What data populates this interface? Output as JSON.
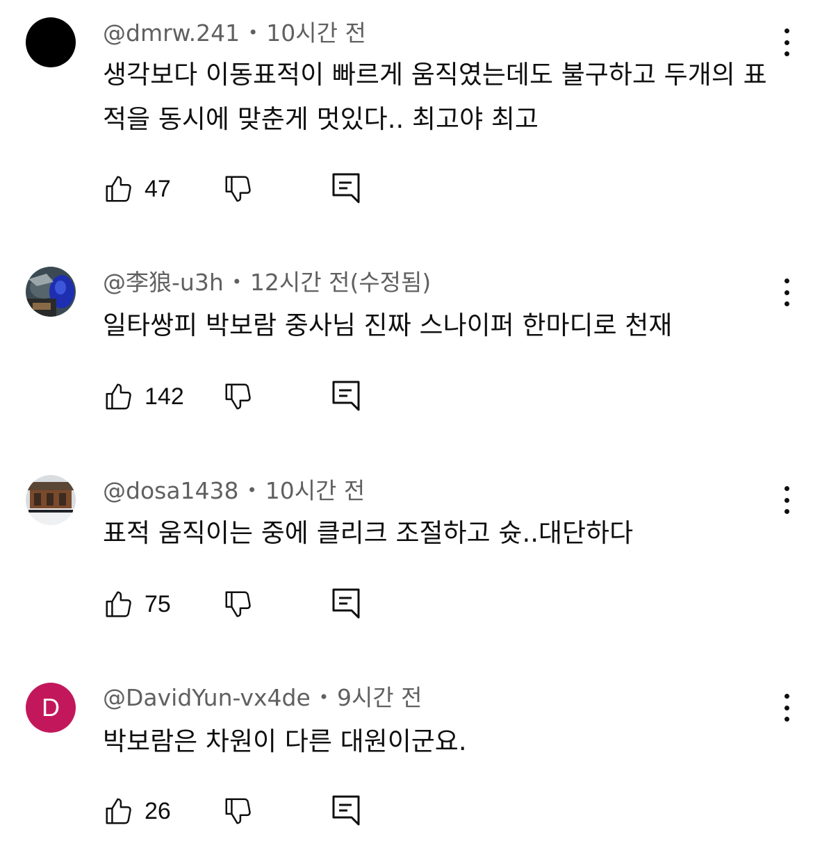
{
  "comments": [
    {
      "handle": "@dmrw.241",
      "separator": "•",
      "time": "10시간 전",
      "text": "생각보다 이동표적이 빠르게 움직였는데도 불구하고 두개의 표적을 동시에 맞춘게 멋있다.. 최고야 최고",
      "likes": "47",
      "avatar": "black-circle"
    },
    {
      "handle": "@李狼-u3h",
      "separator": "•",
      "time": "12시간 전(수정됨)",
      "text": "일타쌍피 박보람 중사님 진짜 스나이퍼 한마디로 천재",
      "likes": "142",
      "avatar": "photo-blue"
    },
    {
      "handle": "@dosa1438",
      "separator": "•",
      "time": "10시간 전",
      "text": "표적 움직이는 중에 클리크 조절하고 슛..대단하다",
      "likes": "75",
      "avatar": "photo-building"
    },
    {
      "handle": "@DavidYun-vx4de",
      "separator": "•",
      "time": "9시간 전",
      "text": "박보람은 차원이 다른 대원이군요.",
      "likes": "26",
      "avatar_letter": "D",
      "avatar_color": "#c2185b"
    }
  ],
  "icons": {
    "like": "thumbs-up-icon",
    "dislike": "thumbs-down-icon",
    "reply": "reply-comment-icon",
    "more": "more-vert-icon"
  }
}
